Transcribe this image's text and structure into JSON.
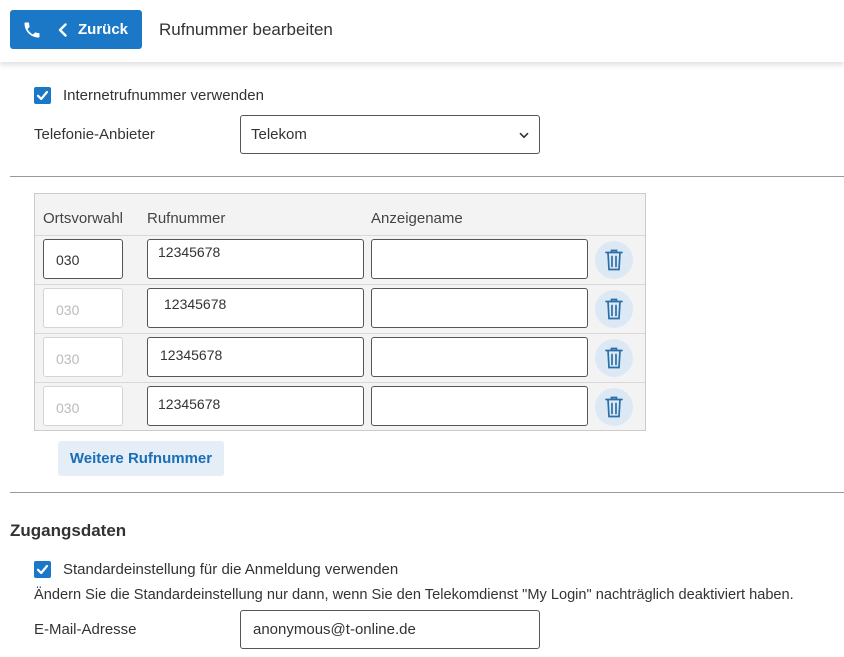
{
  "header": {
    "back_label": "Zurück",
    "title": "Rufnummer bearbeiten"
  },
  "internet": {
    "use_internet_number_label": "Internetrufnummer verwenden",
    "use_internet_number_checked": true,
    "provider_label": "Telefonie-Anbieter",
    "provider_value": "Telekom"
  },
  "numbers_table": {
    "headers": [
      "Ortsvorwahl",
      "Rufnummer",
      "Anzeigename"
    ],
    "rows": [
      {
        "area_code": "030",
        "number": "12345678",
        "display_name": ""
      },
      {
        "area_code": "030",
        "number": "12345678",
        "display_name": ""
      },
      {
        "area_code": "030",
        "number": "12345678",
        "display_name": ""
      },
      {
        "area_code": "030",
        "number": "12345678",
        "display_name": ""
      }
    ],
    "add_button_label": "Weitere Rufnummer"
  },
  "access": {
    "section_title": "Zugangsdaten",
    "use_default_label": "Standardeinstellung für die Anmeldung verwenden",
    "use_default_checked": true,
    "hint": "Ändern Sie die Standardeinstellung nur dann, wenn Sie den Telekomdienst \"My Login\" nachträglich deaktiviert haben.",
    "email_label": "E-Mail-Adresse",
    "email_value": "anonymous@t-online.de"
  },
  "colors": {
    "accent": "#1a78c7",
    "trash_bg": "#dce9f5",
    "button_light_bg": "#e5eef7"
  }
}
